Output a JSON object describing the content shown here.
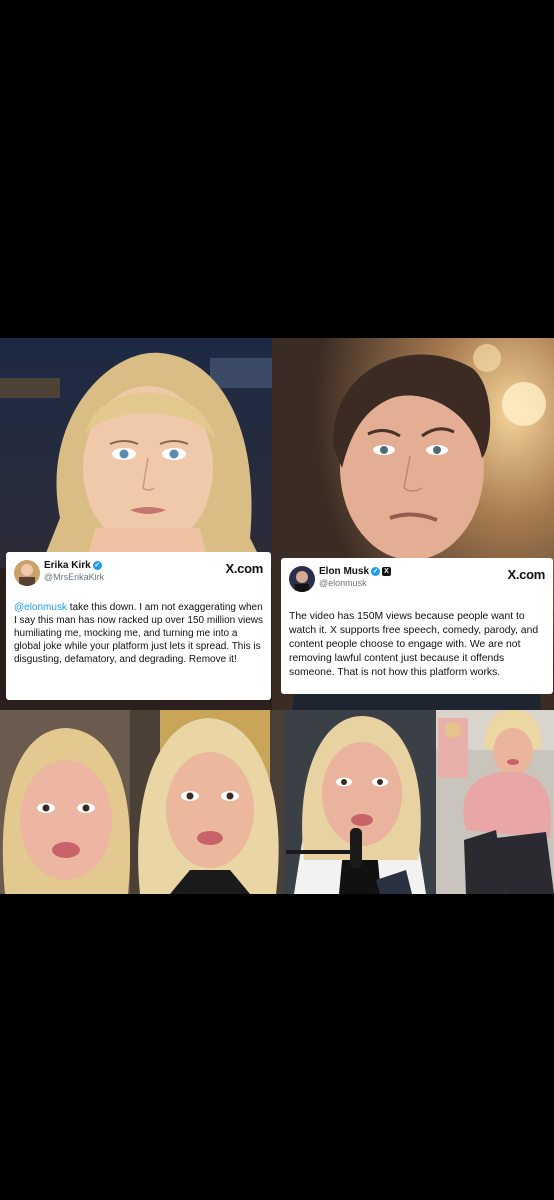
{
  "left_post": {
    "author_name": "Erika Kirk",
    "author_handle": "@MrsErikaKirk",
    "brand": "X.com",
    "verified_icon": "verified-check-icon",
    "mention": "@elonmusk",
    "text": " take this down. I am not exaggerating when I say this man has now racked up over 150 million views humiliating me, mocking me, and turning me into a global joke while your platform just lets it spread. This is disgusting, defamatory, and degrading. Remove it!"
  },
  "right_post": {
    "author_name": "Elon Musk",
    "author_handle": "@elonmusk",
    "brand": "X.com",
    "verified_icon": "verified-check-icon",
    "affiliate_icon": "x-logo-badge-icon",
    "text": "The video has 150M views because people want to watch it. X supports free speech, comedy, parody, and content people choose to engage with. We are not removing lawful content just because it offends someone. That is not how this platform works."
  },
  "colors": {
    "link_blue": "#1d9bf0",
    "page_background": "#000000",
    "card_background": "#ffffff"
  }
}
